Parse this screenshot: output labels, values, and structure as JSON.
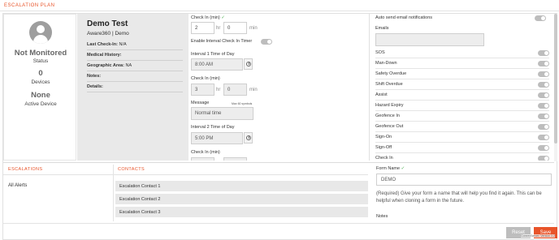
{
  "header": {
    "title": "ESCALATION PLAN"
  },
  "profile": {
    "status_value": "Not Monitored",
    "status_label": "Status",
    "devices_value": "0",
    "devices_label": "Devices",
    "active_value": "None",
    "active_label": "Active Device"
  },
  "info": {
    "name": "Demo Test",
    "org": "Aware360 | Demo",
    "last_checkin_label": "Last Check-In:",
    "last_checkin_value": "N/A",
    "medical_label": "Medical History:",
    "geo_label": "Geographic Area:",
    "geo_value": "NA",
    "notes_label": "Notes:",
    "details_label": "Details:"
  },
  "checkin": {
    "checkin_label": "Check In (min)",
    "check_mark": "✓",
    "hours_value": "2",
    "hr_unit": "hr",
    "minutes_value": "0",
    "min_unit": "min",
    "interval_timer_label": "Enable Interval Check In Timer",
    "interval1_label": "Interval 1 Time of Day",
    "interval1_value": "8:00 AM",
    "checkin2_label": "Check In (min)",
    "hours2_value": "3",
    "minutes2_value": "0",
    "message_label": "Message",
    "message_hint": "Max 60 symbols",
    "message_value": "Normal time",
    "interval2_label": "Interval 2 Time of Day",
    "interval2_value": "5:00 PM",
    "checkin3_label": "Check In (min)"
  },
  "notifications": {
    "auto_email_label": "Auto send email notifications",
    "emails_label": "Emails",
    "items": [
      {
        "label": "SOS"
      },
      {
        "label": "Man-Down"
      },
      {
        "label": "Safety Overdue"
      },
      {
        "label": "Shift Overdue"
      },
      {
        "label": "Assist"
      },
      {
        "label": "Hazard Expiry"
      },
      {
        "label": "Geofence In"
      },
      {
        "label": "Geofence Out"
      },
      {
        "label": "Sign-On"
      },
      {
        "label": "Sign-Off"
      },
      {
        "label": "Check In"
      }
    ]
  },
  "escalations": {
    "title": "ESCALATIONS",
    "items": [
      {
        "label": "All Alerts"
      }
    ]
  },
  "contacts": {
    "title": "CONTACTS",
    "items": [
      {
        "label": "Escalation Contact 1"
      },
      {
        "label": "Escalation Contact 2"
      },
      {
        "label": "Escalation Contact 3"
      }
    ]
  },
  "form": {
    "name_label": "Form Name",
    "check_mark": "✓",
    "name_value": "DEMO",
    "help_text": "(Required) Give your form a name that will help you find it again. This can be helpful when cloning a form in the future.",
    "notes_label": "Notes"
  },
  "footer": {
    "reset_label": "Reset",
    "save_label": "Save",
    "version": "ConnexServer: Version 3.2"
  },
  "colors": {
    "accent": "#e8542a",
    "panel_gray": "#e9e9e9",
    "toggle_off": "#bdbdbd"
  }
}
